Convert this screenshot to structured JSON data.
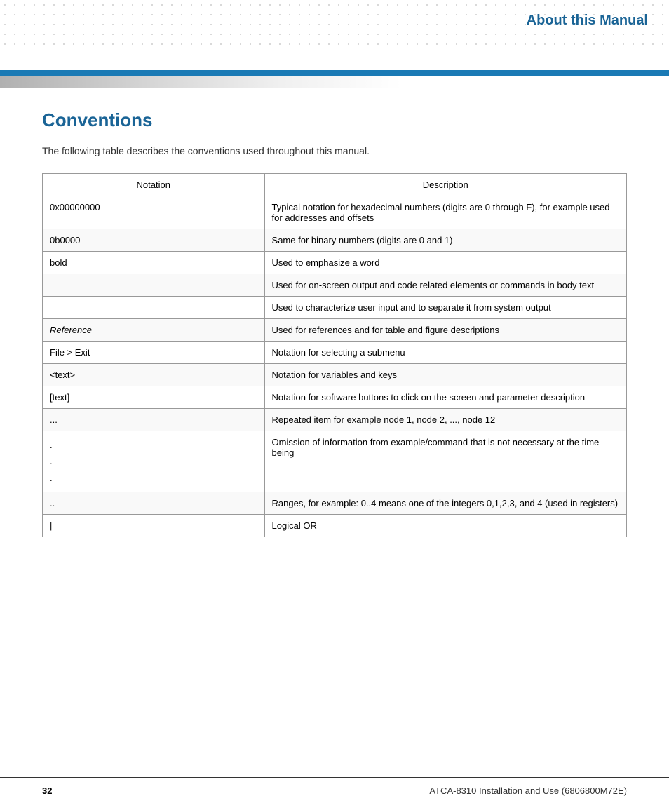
{
  "header": {
    "title": "About this Manual"
  },
  "section": {
    "title": "Conventions",
    "intro": "The following table describes the conventions used throughout this manual."
  },
  "table": {
    "columns": [
      "Notation",
      "Description"
    ],
    "rows": [
      {
        "notation": "0x00000000",
        "description": "Typical notation for hexadecimal numbers (digits are 0 through F), for example used for addresses and offsets"
      },
      {
        "notation": "0b0000",
        "description": "Same for binary numbers (digits are 0 and 1)"
      },
      {
        "notation": "bold",
        "description": "Used to emphasize a word"
      },
      {
        "notation": "",
        "description": "Used for on-screen output and code related elements or commands in body text"
      },
      {
        "notation": "",
        "description": "Used to characterize user input and to separate it from system output"
      },
      {
        "notation": "Reference",
        "notation_style": "italic",
        "description": "Used for references and for table and figure descriptions"
      },
      {
        "notation": "File > Exit",
        "description": "Notation for selecting a submenu"
      },
      {
        "notation": "<text>",
        "description": "Notation for variables and keys"
      },
      {
        "notation": "[text]",
        "description": "Notation for software buttons to click on the screen and parameter description"
      },
      {
        "notation": "...",
        "description": "Repeated item for example node 1, node 2, ..., node 12"
      },
      {
        "notation": ".\n.\n.",
        "notation_style": "dots",
        "description": "Omission of information from example/command that is not necessary at the time being"
      },
      {
        "notation": "..",
        "description": "Ranges, for example: 0..4 means one of the integers 0,1,2,3, and 4 (used in registers)"
      },
      {
        "notation": "|",
        "description": "Logical OR"
      }
    ]
  },
  "footer": {
    "page_number": "32",
    "document_title": "ATCA-8310 Installation and Use (6806800M72E)"
  }
}
